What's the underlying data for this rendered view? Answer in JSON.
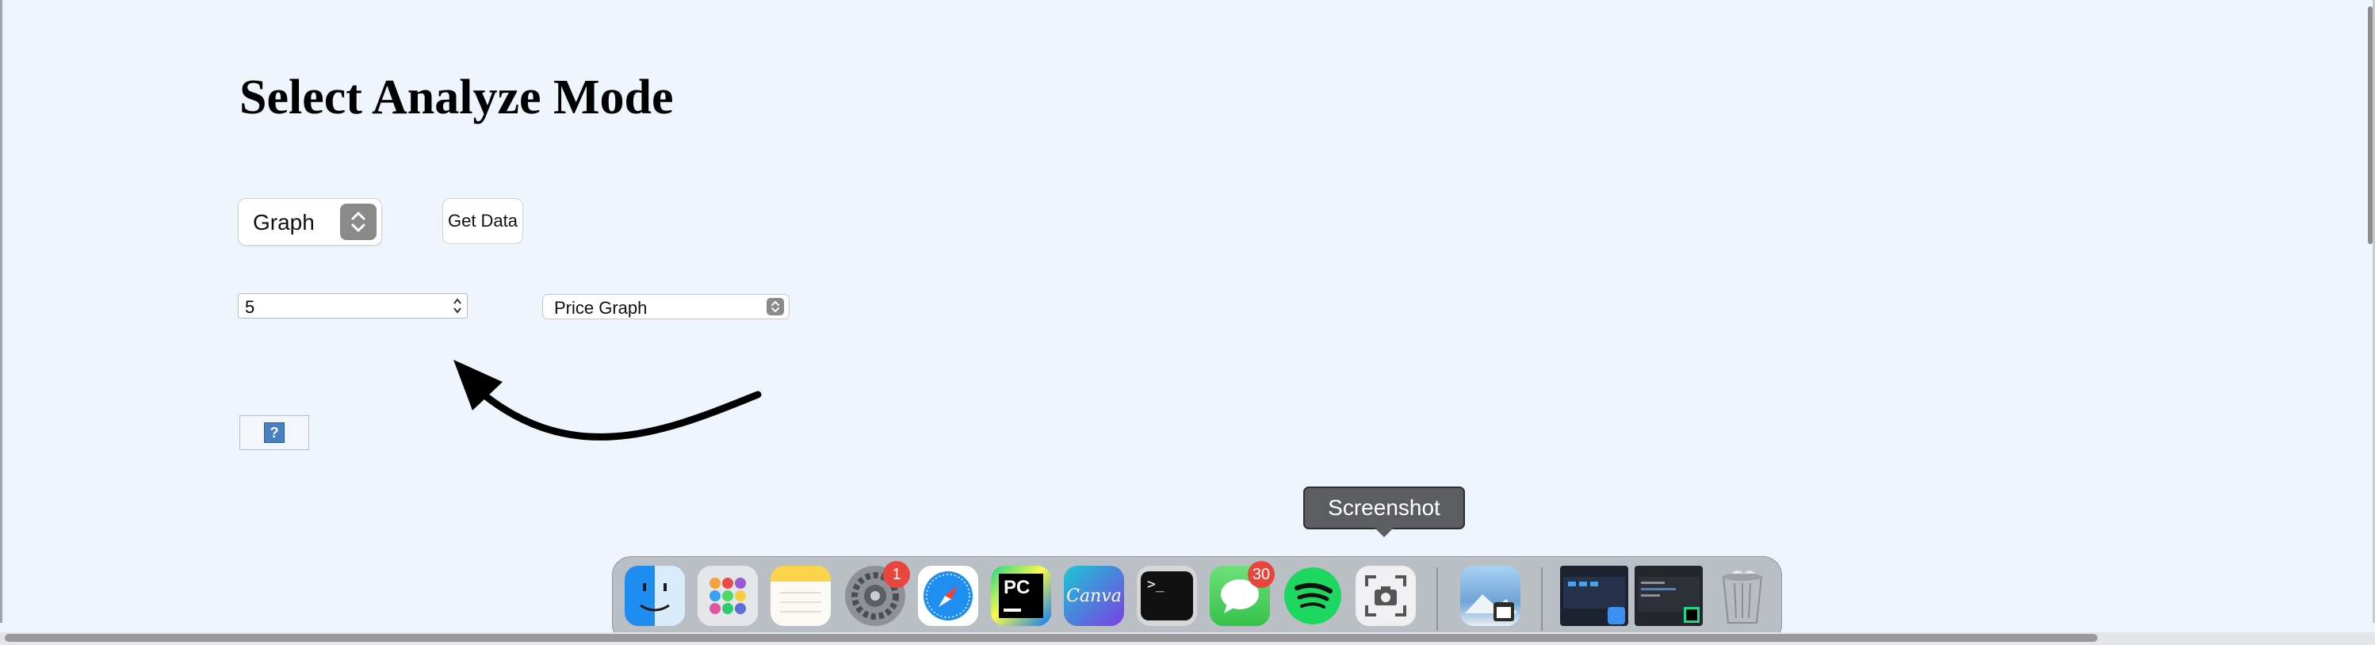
{
  "page": {
    "title": "Select Analyze Mode"
  },
  "controls": {
    "mode_select_value": "Graph",
    "get_data_label": "Get Data",
    "number_value": "5",
    "graph_type_value": "Price Graph",
    "help_label": "?"
  },
  "tooltip": {
    "text": "Screenshot"
  },
  "dock": {
    "items": [
      {
        "name": "Finder",
        "icon": "finder-icon"
      },
      {
        "name": "Launchpad",
        "icon": "launchpad-icon"
      },
      {
        "name": "Notes",
        "icon": "notes-icon"
      },
      {
        "name": "System Settings",
        "icon": "settings-icon",
        "badge": "1"
      },
      {
        "name": "Safari",
        "icon": "safari-icon"
      },
      {
        "name": "PyCharm",
        "icon": "pycharm-icon",
        "text": "PC"
      },
      {
        "name": "Canva",
        "icon": "canva-icon",
        "text": "Canva"
      },
      {
        "name": "Terminal",
        "icon": "terminal-icon",
        "text": ">_"
      },
      {
        "name": "Messages",
        "icon": "messages-icon",
        "badge": "30"
      },
      {
        "name": "Spotify",
        "icon": "spotify-icon"
      },
      {
        "name": "Screenshot",
        "icon": "screenshot-icon"
      },
      {
        "name": "Preview",
        "icon": "preview-icon"
      },
      {
        "name": "Finder window",
        "icon": "finder-window-thumbnail"
      },
      {
        "name": "PyCharm window",
        "icon": "pycharm-window-thumbnail"
      },
      {
        "name": "Trash",
        "icon": "trash-icon"
      }
    ]
  },
  "colors": {
    "page_background": "#eef5fd",
    "badge": "#e8453c",
    "pycharm_green": "#21d789",
    "spotify_green": "#1ed760"
  }
}
